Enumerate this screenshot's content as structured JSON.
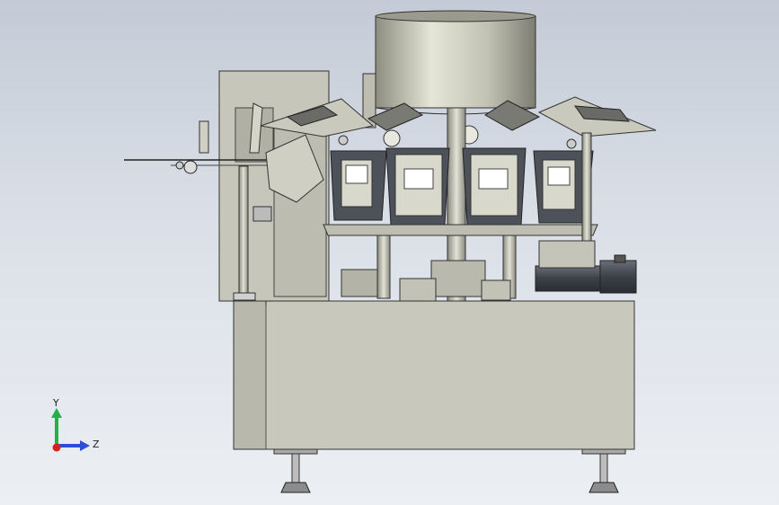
{
  "viewport": {
    "background_top": "#c4cbd6",
    "background_bottom": "#eceff3",
    "model_colors": {
      "body": "#c9c9bd",
      "body_shade": "#b4b4a8",
      "edge": "#333333",
      "drum": "#cfcfc0",
      "bucket": "#5a5e66",
      "motor": "#4a4e56"
    }
  },
  "triad": {
    "y_label": "Y",
    "z_label": "Z",
    "y_color": "#22b04a",
    "z_color": "#2b4fd8",
    "x_color": "#d42222"
  }
}
